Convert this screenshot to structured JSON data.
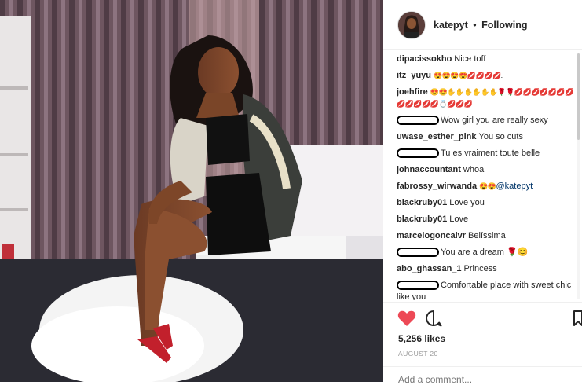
{
  "post": {
    "username": "katepyt",
    "separator": "•",
    "follow_state": "Following"
  },
  "comments": [
    {
      "user": "dipacissokho",
      "text": "Nice toff",
      "redacted": false
    },
    {
      "user": "itz_yuyu",
      "text": "😍😍😍😍💋💋💋💋.",
      "redacted": false
    },
    {
      "user": "joehfire",
      "text": "😍😍✋✋✋✋✋✋🌹🌹💋💋💋💋💋💋💋💋💋💋💋💋💍💋💋💋",
      "redacted": false
    },
    {
      "user": "",
      "text": "Wow girl you are really sexy",
      "redacted": true
    },
    {
      "user": "uwase_esther_pink",
      "text": "You so cuts",
      "redacted": false
    },
    {
      "user": "",
      "text": "Tu es vraiment toute belle",
      "redacted": true
    },
    {
      "user": "johnaccountant",
      "text": "whoa",
      "redacted": false
    },
    {
      "user": "fabrossy_wirwanda",
      "text": "😍😍",
      "mention": "@katepyt",
      "redacted": false
    },
    {
      "user": "blackruby01",
      "text": "Love you",
      "redacted": false
    },
    {
      "user": "blackruby01",
      "text": "Love",
      "redacted": false
    },
    {
      "user": "marcelogoncalvr",
      "text": "Belíssima",
      "redacted": false
    },
    {
      "user": "",
      "text": "You are a dream 🌹😊",
      "redacted": true
    },
    {
      "user": "abo_ghassan_1",
      "text": "Princess",
      "redacted": false
    },
    {
      "user": "",
      "text": "Comfortable place with sweet chic like you",
      "redacted": true
    }
  ],
  "actions": {
    "like_icon": "heart-icon",
    "comment_icon": "comment-icon",
    "save_icon": "bookmark-icon",
    "like_color": "#ed4956"
  },
  "likes": "5,256 likes",
  "date": "AUGUST 20",
  "add_comment_placeholder": "Add a comment..."
}
